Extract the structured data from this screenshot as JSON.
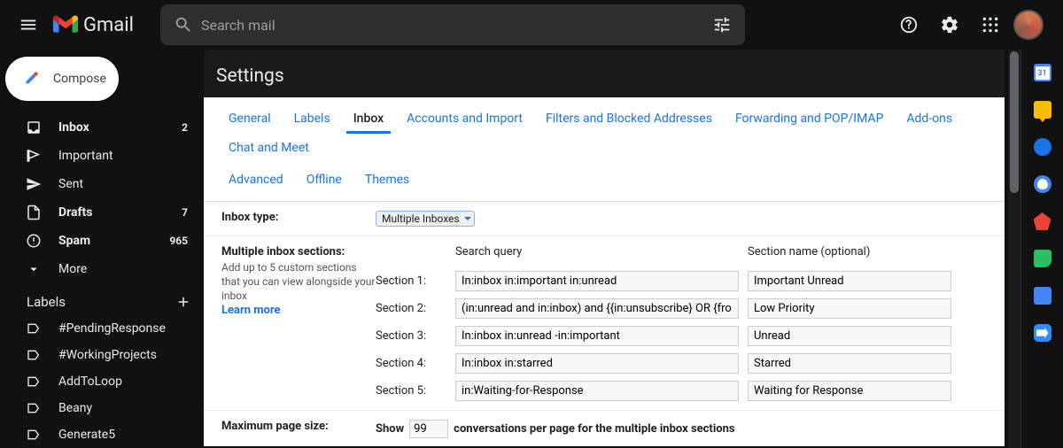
{
  "brand": "Gmail",
  "search": {
    "placeholder": "Search mail"
  },
  "compose_label": "Compose",
  "nav": [
    {
      "icon": "inbox",
      "label": "Inbox",
      "count": "2",
      "bold": true
    },
    {
      "icon": "flag",
      "label": "Important",
      "count": "",
      "bold": false
    },
    {
      "icon": "send",
      "label": "Sent",
      "count": "",
      "bold": false
    },
    {
      "icon": "file",
      "label": "Drafts",
      "count": "7",
      "bold": true
    },
    {
      "icon": "spam",
      "label": "Spam",
      "count": "965",
      "bold": true
    },
    {
      "icon": "chevron-down",
      "label": "More",
      "count": "",
      "bold": false
    }
  ],
  "labels_header": "Labels",
  "labels": [
    "#PendingResponse",
    "#WorkingProjects",
    "AddToLoop",
    "Beany",
    "Generate5"
  ],
  "settings": {
    "title": "Settings",
    "tabs_row1": [
      "General",
      "Labels",
      "Inbox",
      "Accounts and Import",
      "Filters and Blocked Addresses",
      "Forwarding and POP/IMAP",
      "Add-ons",
      "Chat and Meet"
    ],
    "tabs_row2": [
      "Advanced",
      "Offline",
      "Themes"
    ],
    "active_tab": "Inbox",
    "inbox_type": {
      "label": "Inbox type:",
      "value": "Multiple Inboxes"
    },
    "sections": {
      "label": "Multiple inbox sections:",
      "sub": "Add up to 5 custom sections that you can view alongside your inbox",
      "learn_more": "Learn more",
      "col_query": "Search query",
      "col_name": "Section name (optional)",
      "rows": [
        {
          "label": "Section 1:",
          "q": "In:inbox in:important in:unread",
          "name": "Important Unread"
        },
        {
          "label": "Section 2:",
          "q": "(in:unread and in:inbox) and {{in:unsubscribe} OR {fro",
          "name": "Low Priority"
        },
        {
          "label": "Section 3:",
          "q": "In:inbox in:unread -in:important",
          "name": "Unread"
        },
        {
          "label": "Section 4:",
          "q": "In:inbox in:starred",
          "name": "Starred"
        },
        {
          "label": "Section 5:",
          "q": "in:Waiting-for-Response",
          "name": "Waiting for Response"
        }
      ]
    },
    "pagesize": {
      "label": "Maximum page size:",
      "show": "Show",
      "value": "99",
      "suffix": "conversations per page for the multiple inbox sections"
    }
  }
}
